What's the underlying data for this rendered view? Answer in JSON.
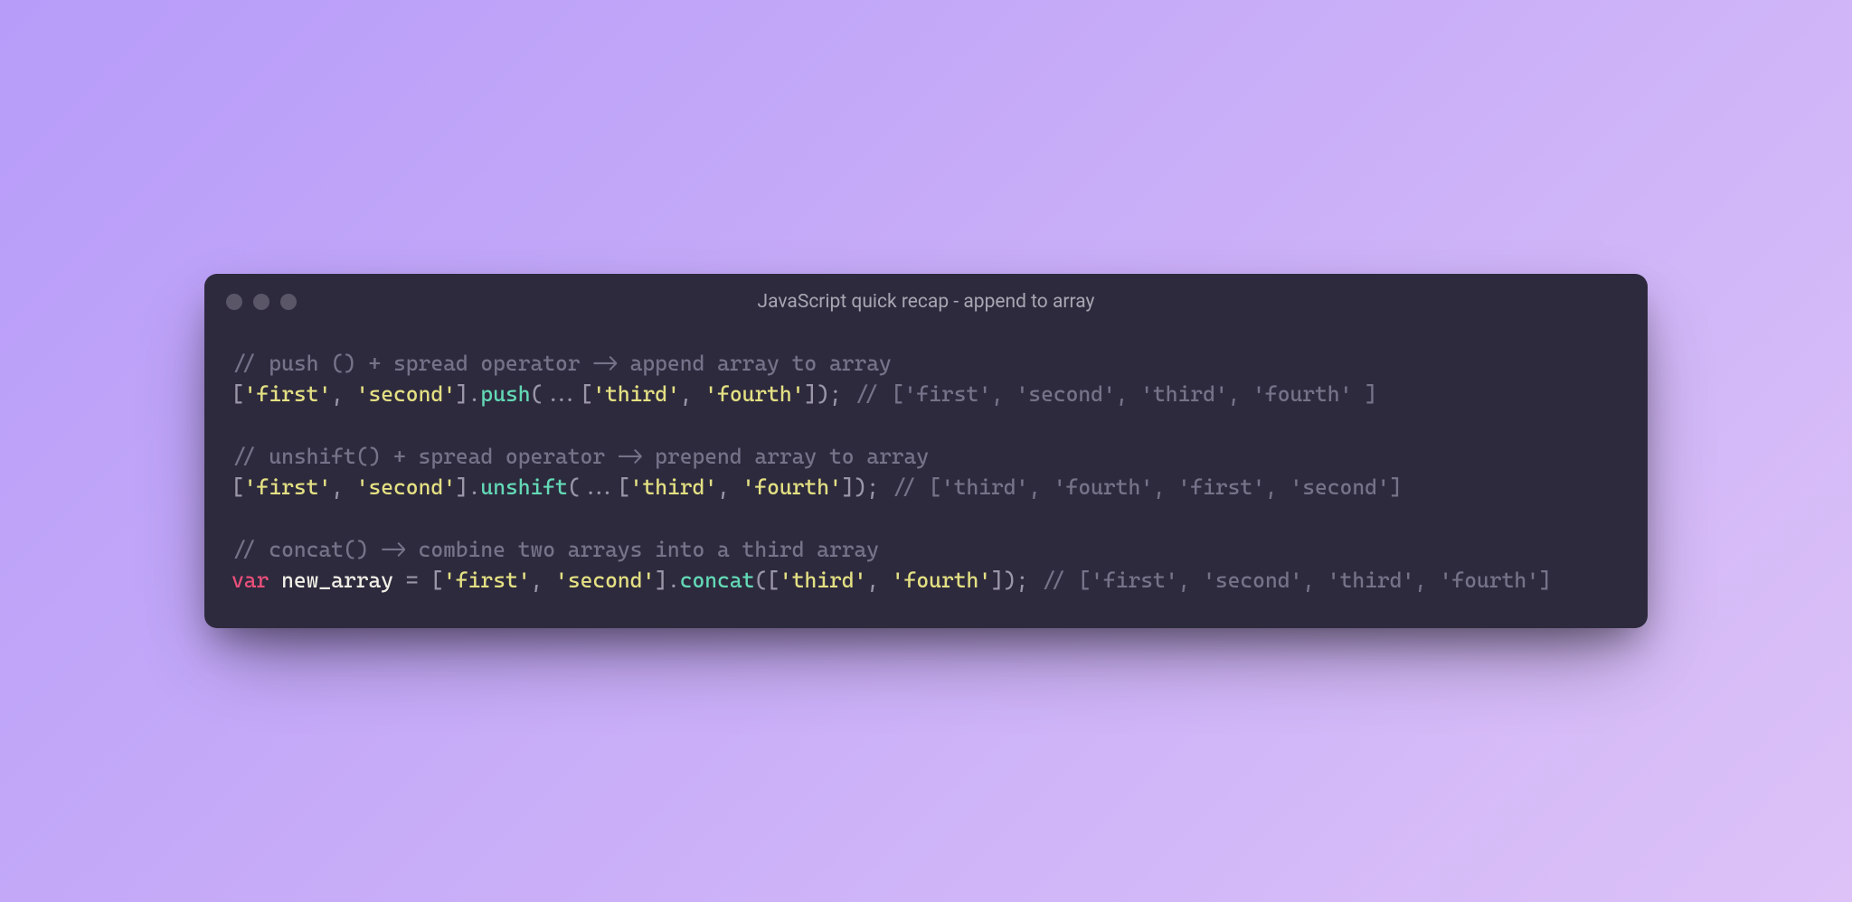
{
  "window": {
    "title": "JavaScript quick recap - append to array"
  },
  "code": {
    "blocks": [
      {
        "comment": "// push () + spread operator -> append array to array",
        "expr": {
          "open1": "[",
          "s1": "'first'",
          "c1": ", ",
          "s2": "'second'",
          "close1": "].",
          "method": "push",
          "paren_open": "(...[",
          "s3": "'third'",
          "c2": ", ",
          "s4": "'fourth'",
          "paren_close": "]); ",
          "trail": "// ['first', 'second', 'third', 'fourth' ]"
        }
      },
      {
        "comment": "// unshift() + spread operator -> prepend array to array",
        "expr": {
          "open1": "[",
          "s1": "'first'",
          "c1": ", ",
          "s2": "'second'",
          "close1": "].",
          "method": "unshift",
          "paren_open": "(...[",
          "s3": "'third'",
          "c2": ", ",
          "s4": "'fourth'",
          "paren_close": "]); ",
          "trail": "// ['third', 'fourth', 'first', 'second']"
        }
      },
      {
        "comment": "// concat() -> combine two arrays into a third array",
        "expr": {
          "kw": "var",
          "sp1": " ",
          "ident": "new_array",
          "eq": " = [",
          "s1": "'first'",
          "c1": ", ",
          "s2": "'second'",
          "close1": "].",
          "method": "concat",
          "paren_open": "([",
          "s3": "'third'",
          "c2": ", ",
          "s4": "'fourth'",
          "paren_close": "]); ",
          "trail": "// ['first', 'second', 'third', 'fourth']"
        }
      }
    ]
  }
}
